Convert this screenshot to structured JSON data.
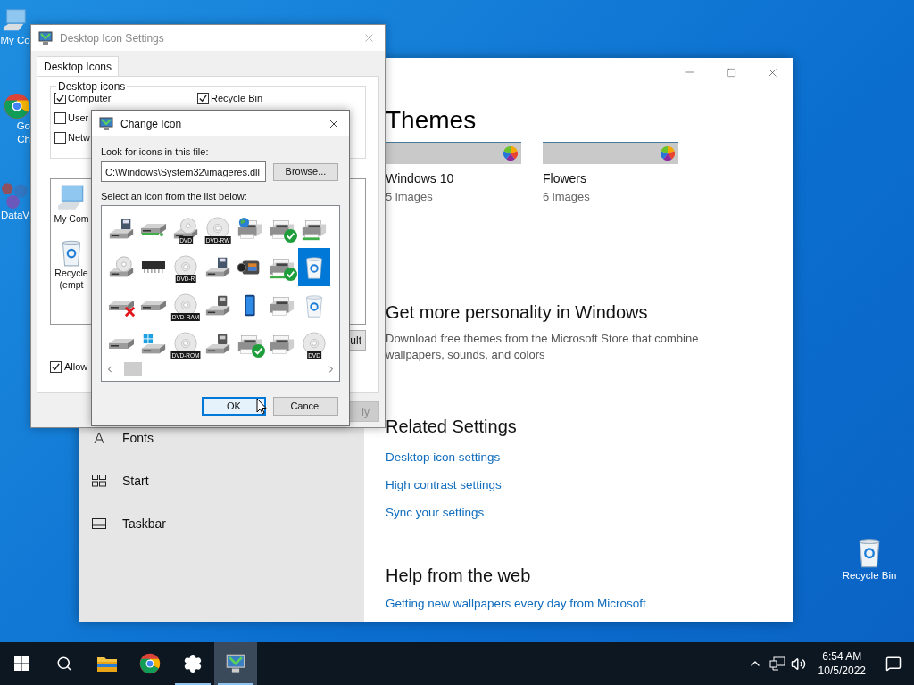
{
  "desktop_icons": [
    {
      "kind": "computer",
      "lines": [
        "My Co"
      ]
    },
    {
      "kind": "chrome",
      "lines": [
        "Go",
        "Ch"
      ]
    },
    {
      "kind": "data",
      "lines": [
        "DataV"
      ]
    },
    {
      "kind": "bin",
      "lines": [
        "Recycle Bin"
      ]
    }
  ],
  "settings": {
    "sidebar": [
      {
        "kind": "fonts",
        "label": "Fonts"
      },
      {
        "kind": "start",
        "label": "Start"
      },
      {
        "kind": "taskbar",
        "label": "Taskbar"
      }
    ],
    "themes_heading": "Themes",
    "themes": [
      {
        "name": "Windows 10",
        "count": "5 images"
      },
      {
        "name": "Flowers",
        "count": "6 images"
      }
    ],
    "personality": {
      "heading": "Get more personality in Windows",
      "text": "Download free themes from the Microsoft Store that combine wallpapers, sounds, and colors"
    },
    "related": {
      "heading": "Related Settings",
      "links": [
        "Desktop icon settings",
        "High contrast settings",
        "Sync your settings"
      ]
    },
    "help": {
      "heading": "Help from the web",
      "links": [
        "Getting new wallpapers every day from Microsoft"
      ]
    }
  },
  "icon_settings": {
    "title": "Desktop Icon Settings",
    "tabs": [
      {
        "label": "Desktop Icons",
        "selected": true
      }
    ],
    "group_title": "Desktop icons",
    "checkbox_columns": [
      [
        {
          "label": "Computer",
          "checked": true
        },
        {
          "label": "User",
          "checked": false
        },
        {
          "label": "Netw",
          "checked": false
        }
      ],
      [
        {
          "label": "Recycle Bin",
          "checked": true
        }
      ]
    ],
    "preview_icons": [
      {
        "kind": "computer",
        "lines": [
          "My Com"
        ]
      },
      {
        "kind": "bin",
        "lines": [
          "Recycle",
          "(empt"
        ]
      }
    ],
    "restore_button": "ult",
    "allow_checkbox": {
      "label": "Allow",
      "checked": true
    },
    "apply_button": {
      "label": "ly",
      "disabled": true
    }
  },
  "change_icon": {
    "title": "Change Icon",
    "file_label": "Look for icons in this file:",
    "file_value": "C:\\Windows\\System32\\imageres.dll",
    "browse_button": "Browse...",
    "list_label": "Select an icon from the list below:",
    "icons": [
      {
        "kind": "floppy",
        "selected": false
      },
      {
        "kind": "netdrive",
        "selected": false
      },
      {
        "kind": "cddrive",
        "label": "DVD",
        "selected": false
      },
      {
        "kind": "disc",
        "label": "DVD-RW",
        "selected": false
      },
      {
        "kind": "globe-printer",
        "selected": false
      },
      {
        "kind": "printer-ok",
        "selected": false
      },
      {
        "kind": "netprinter",
        "selected": false
      },
      {
        "kind": "cddrive",
        "selected": false
      },
      {
        "kind": "chip",
        "selected": false
      },
      {
        "kind": "disc",
        "label": "DVD-R",
        "selected": false
      },
      {
        "kind": "floppy",
        "selected": false
      },
      {
        "kind": "camera",
        "selected": false
      },
      {
        "kind": "netprinter-ok",
        "selected": false
      },
      {
        "kind": "bin",
        "selected": true
      },
      {
        "kind": "drive-error",
        "selected": false
      },
      {
        "kind": "drive",
        "selected": false
      },
      {
        "kind": "disc",
        "label": "DVD-RAM",
        "selected": false
      },
      {
        "kind": "carddrive",
        "selected": false
      },
      {
        "kind": "phone",
        "selected": false
      },
      {
        "kind": "printer",
        "selected": false
      },
      {
        "kind": "bin",
        "selected": false
      },
      {
        "kind": "drive",
        "selected": false
      },
      {
        "kind": "windows-drive",
        "selected": false
      },
      {
        "kind": "disc",
        "label": "DVD-ROM",
        "selected": false
      },
      {
        "kind": "carddrive",
        "selected": false
      },
      {
        "kind": "printer-ok",
        "selected": false
      },
      {
        "kind": "printer",
        "selected": false
      },
      {
        "kind": "disc",
        "label": "DVD",
        "selected": false
      }
    ],
    "ok_button": "OK",
    "cancel_button": "Cancel"
  },
  "taskbar": {
    "apps": [
      {
        "kind": "explorer",
        "running": false,
        "focused": false
      },
      {
        "kind": "chrome",
        "running": false,
        "focused": false
      },
      {
        "kind": "settings",
        "running": true,
        "focused": false
      },
      {
        "kind": "display",
        "running": true,
        "focused": true
      }
    ],
    "time": "6:54 AM",
    "date": "10/5/2022"
  }
}
